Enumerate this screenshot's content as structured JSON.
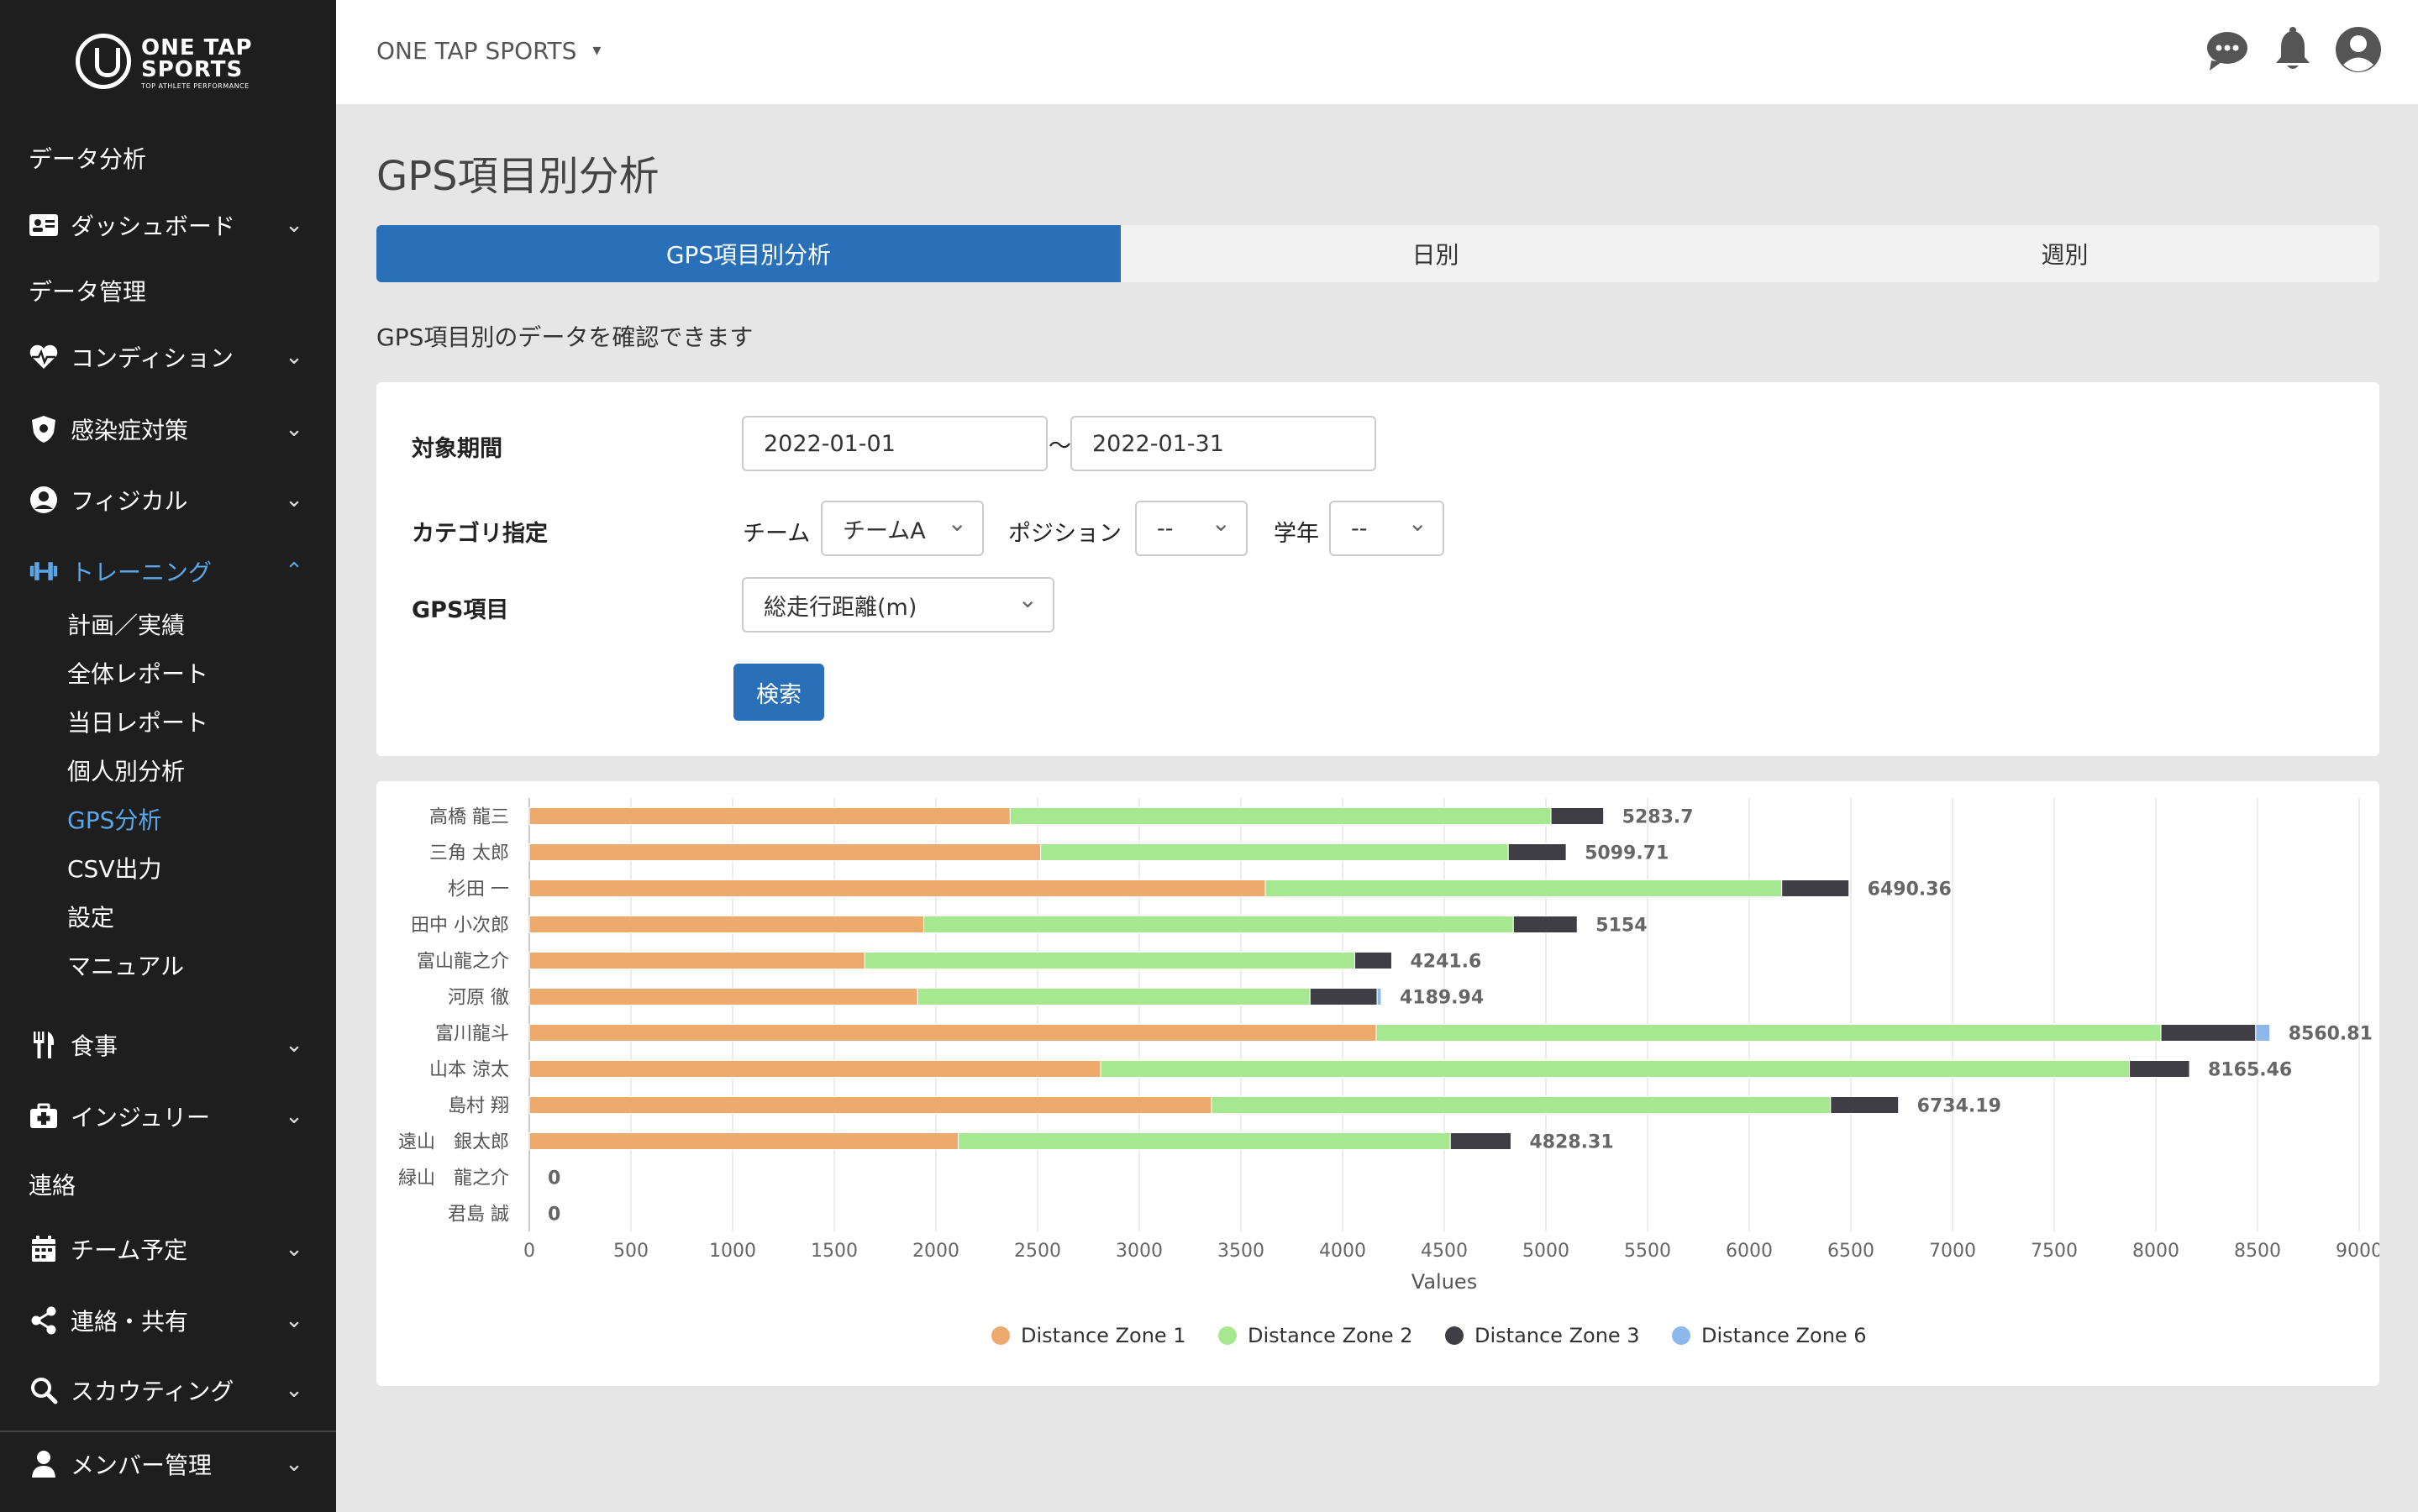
{
  "app": {
    "brand": "ONE TAP SPORTS",
    "logo_line1": "ONE TAP",
    "logo_line2": "SPORTS",
    "logo_tagline": "TOP ATHLETE PERFORMANCE"
  },
  "sidebar": {
    "heading_data_analysis": "データ分析",
    "dashboard": "ダッシュボード",
    "heading_data_management": "データ管理",
    "condition": "コンディション",
    "infection": "感染症対策",
    "physical": "フィジカル",
    "training": "トレーニング",
    "training_sub": [
      "計画／実績",
      "全体レポート",
      "当日レポート",
      "個人別分析",
      "GPS分析",
      "CSV出力",
      "設定",
      "マニュアル"
    ],
    "meal": "食事",
    "injury": "インジュリー",
    "heading_contact": "連絡",
    "team_schedule": "チーム予定",
    "share": "連絡・共有",
    "scouting": "スカウティング",
    "members": "メンバー管理"
  },
  "page": {
    "title": "GPS項目別分析",
    "tabs": [
      "GPS項目別分析",
      "日別",
      "週別"
    ],
    "description": "GPS項目別のデータを確認できます"
  },
  "filter": {
    "period_label": "対象期間",
    "date_from": "2022-01-01",
    "date_sep": "〜",
    "date_to": "2022-01-31",
    "category_label": "カテゴリ指定",
    "team_label": "チーム",
    "team_value": "チームA",
    "position_label": "ポジション",
    "position_value": "--",
    "grade_label": "学年",
    "grade_value": "--",
    "gps_label": "GPS項目",
    "gps_value": "総走行距離(m)",
    "search_button": "検索"
  },
  "colors": {
    "zone1": "#eeaa6c",
    "zone2": "#a6e890",
    "zone3": "#3e3e44",
    "zone6": "#8cb8ec",
    "accent": "#2a70b8"
  },
  "chart_data": {
    "type": "bar",
    "orientation": "horizontal",
    "stacked": true,
    "categories": [
      "高橋 龍三",
      "三角 太郎",
      "杉田 一",
      "田中 小次郎",
      "富山龍之介",
      "河原 徹",
      "富川龍斗",
      "山本 涼太",
      "島村 翔",
      "遠山　銀太郎",
      "緑山　龍之介",
      "君島 誠"
    ],
    "series": [
      {
        "name": "Distance Zone 1",
        "values": [
          2365,
          2515,
          3620,
          1940,
          1650,
          1910,
          4165,
          2810,
          3355,
          2110,
          0,
          0
        ]
      },
      {
        "name": "Distance Zone 2",
        "values": [
          2660,
          2300,
          2540,
          2900,
          2410,
          1930,
          3860,
          5060,
          3045,
          2420,
          0,
          0
        ]
      },
      {
        "name": "Distance Zone 3",
        "values": [
          258.7,
          284.71,
          330.36,
          314,
          181.6,
          329.94,
          465.81,
          295.46,
          334.19,
          298.31,
          0,
          0
        ]
      },
      {
        "name": "Distance Zone 6",
        "values": [
          0,
          0,
          0,
          0,
          0,
          20,
          70,
          0,
          0,
          0,
          0,
          0
        ]
      }
    ],
    "totals": [
      "5283.7",
      "5099.71",
      "6490.36",
      "5154",
      "4241.6",
      "4189.94",
      "8560.81",
      "8165.46",
      "6734.19",
      "4828.31",
      "0",
      "0"
    ],
    "xticks": [
      0,
      500,
      1000,
      1500,
      2000,
      2500,
      3000,
      3500,
      4000,
      4500,
      5000,
      5500,
      6000,
      6500,
      7000,
      7500,
      8000,
      8500,
      9000
    ],
    "xlabel": "Values",
    "xlim": [
      0,
      9000
    ],
    "grid": true,
    "legend": "bottom"
  }
}
